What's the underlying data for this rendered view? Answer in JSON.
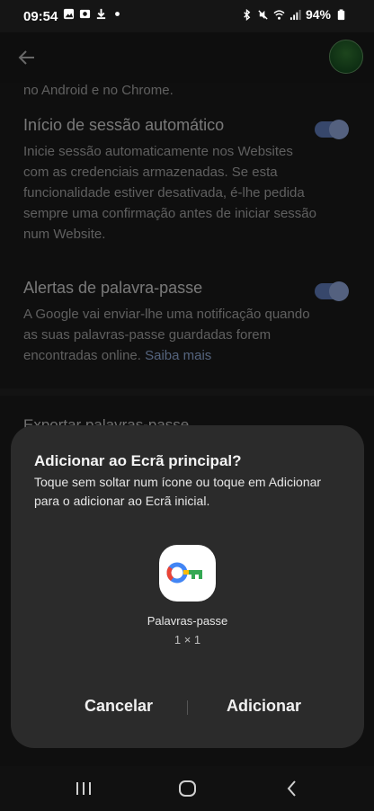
{
  "status_bar": {
    "time": "09:54",
    "battery": "94%",
    "icons_left": [
      "gallery-icon",
      "photos-icon",
      "download-icon",
      "dot-icon"
    ],
    "icons_right": [
      "bluetooth-icon",
      "mute-icon",
      "wifi-icon",
      "signal-icon",
      "battery-icon"
    ]
  },
  "settings": {
    "cut_off_text": "no Android e no Chrome.",
    "auto_signin": {
      "title": "Início de sessão automático",
      "description": "Inicie sessão automaticamente nos Websites com as credenciais armazenadas. Se esta funcionalidade estiver desativada, é-lhe pedida sempre uma confirmação antes de iniciar sessão num Website.",
      "enabled": true
    },
    "password_alerts": {
      "title": "Alertas de palavra-passe",
      "description": "A Google vai enviar-lhe uma notificação quando as suas palavras-passe guardadas forem encontradas online.",
      "link": "Saiba mais",
      "enabled": true
    },
    "export_label": "Exportar palavras-passe"
  },
  "dialog": {
    "title": "Adicionar ao Ecrã principal?",
    "message": "Toque sem soltar num ícone ou toque em Adicionar para o adicionar ao Ecrã inicial.",
    "app_name": "Palavras-passe",
    "app_size": "1 × 1",
    "cancel_label": "Cancelar",
    "add_label": "Adicionar"
  },
  "colors": {
    "toggle_on": "#6e8fd6",
    "link": "#a8c7fa",
    "dialog_bg": "#2b2b2b"
  }
}
